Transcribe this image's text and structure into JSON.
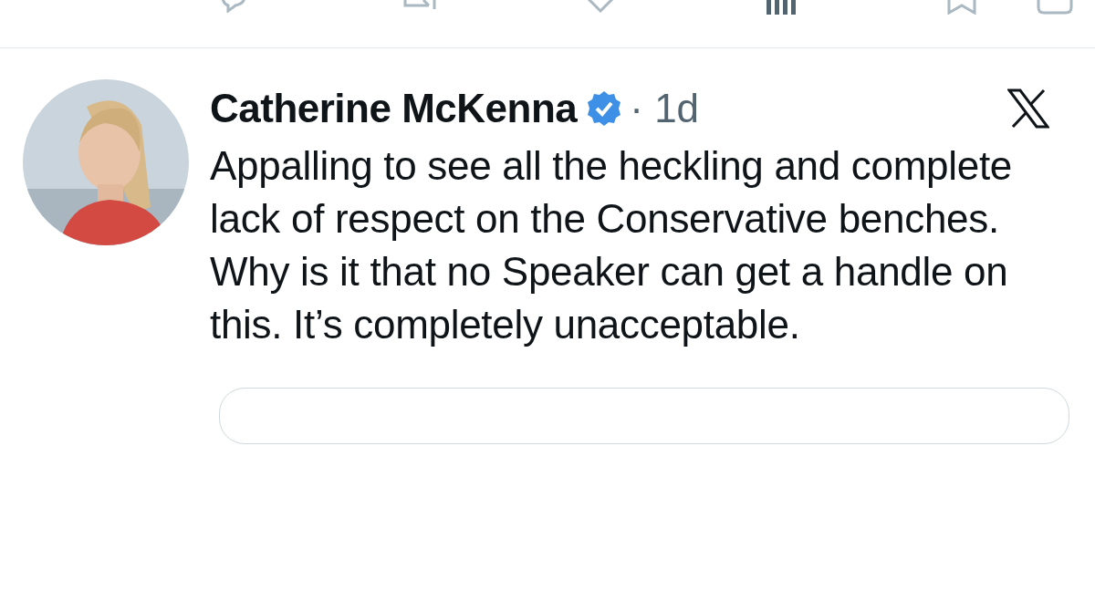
{
  "tweet": {
    "author": "Catherine McKenna",
    "verified": true,
    "time": "· 1d",
    "text": "Appalling to see all the heckling and complete lack of respect on the Conservative benches. Why is it that no Speaker can get a handle on this. It’s completely unacceptable."
  }
}
